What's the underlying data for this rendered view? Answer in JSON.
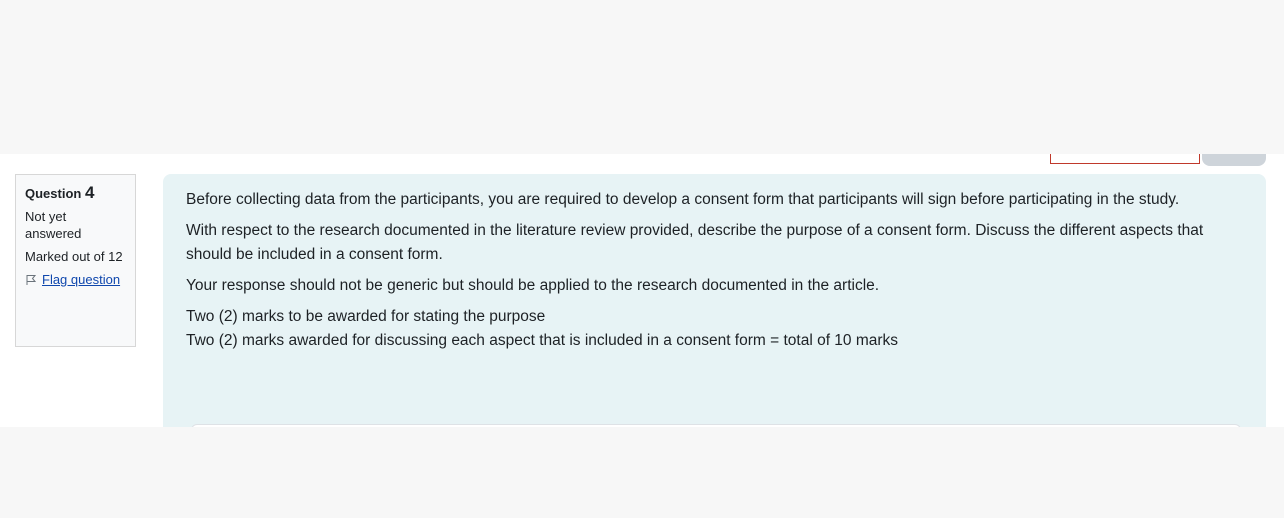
{
  "question": {
    "label": "Question",
    "number": "4",
    "state": "Not yet answered",
    "grade": "Marked out of 12",
    "flag_label": "Flag question"
  },
  "formulation": {
    "paragraph1": "Before collecting data from the participants, you are required to develop a consent form that participants will sign before participating in the study.",
    "paragraph2": "With respect to the research documented in the literature review provided, describe the purpose of a consent form. Discuss the different aspects that should be included in a consent form.",
    "paragraph3": "Your response should not be generic but should be applied to the research documented in the article.",
    "line4a": "Two (2) marks to be awarded for stating the purpose",
    "line4b": "Two (2) marks awarded for discussing each aspect that is included in a consent form = total of 10 marks"
  },
  "colors": {
    "formulation_bg": "#e7f3f5",
    "link": "#0f47ad",
    "info_border": "#d7d7d7"
  },
  "icons": {
    "flag": "flag-icon"
  }
}
